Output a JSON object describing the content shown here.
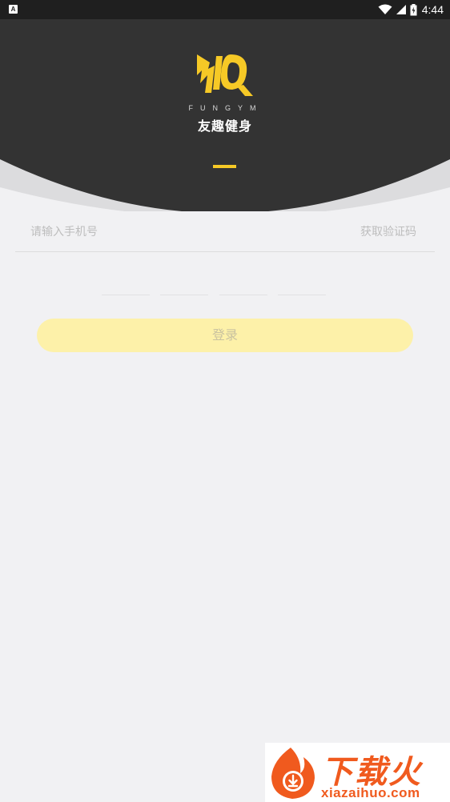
{
  "status_bar": {
    "left_icon_name": "a-notification-icon",
    "left_icon_text": "A",
    "icons": [
      "wifi-icon",
      "signal-icon",
      "battery-icon"
    ],
    "time": "4:44"
  },
  "header": {
    "logo_name": "fungym-logo",
    "brand_en": "FUNGYM",
    "brand_cn": "友趣健身",
    "accent_color": "#f6c926",
    "background_color": "#333333"
  },
  "form": {
    "phone_placeholder": "请输入手机号",
    "get_code_label": "获取验证码",
    "code_boxes": [
      "",
      "",
      "",
      ""
    ],
    "login_label": "登录"
  },
  "watermark": {
    "logo_name": "xiazaihuo-flame-logo",
    "text_cn": "下载火",
    "url": "xiazaihuo.com"
  }
}
